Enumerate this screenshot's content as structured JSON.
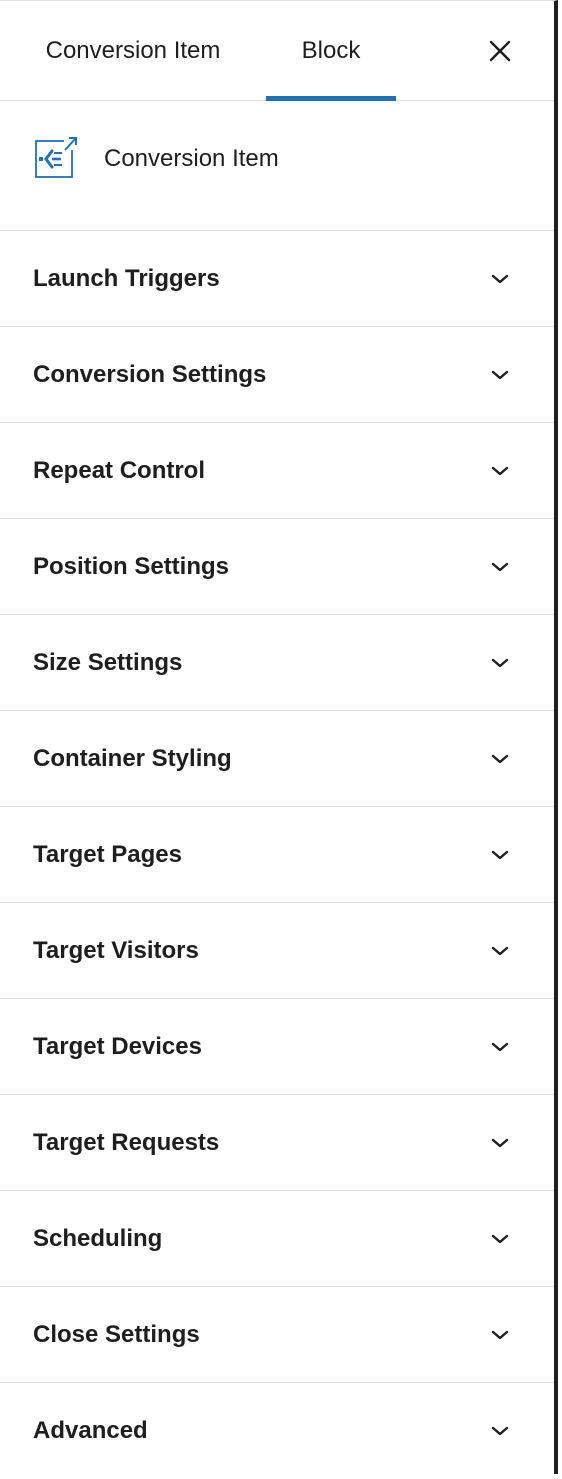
{
  "tabs": {
    "items": [
      {
        "label": "Conversion Item",
        "active": false
      },
      {
        "label": "Block",
        "active": true
      }
    ],
    "close_icon": "close-icon"
  },
  "block": {
    "title": "Conversion Item",
    "icon": "conversion-item-icon"
  },
  "sections": [
    {
      "label": "Launch Triggers",
      "icon": "chevron-down-icon"
    },
    {
      "label": "Conversion Settings",
      "icon": "chevron-down-icon"
    },
    {
      "label": "Repeat Control",
      "icon": "chevron-down-icon"
    },
    {
      "label": "Position Settings",
      "icon": "chevron-down-icon"
    },
    {
      "label": "Size Settings",
      "icon": "chevron-down-icon"
    },
    {
      "label": "Container Styling",
      "icon": "chevron-down-icon"
    },
    {
      "label": "Target Pages",
      "icon": "chevron-down-icon"
    },
    {
      "label": "Target Visitors",
      "icon": "chevron-down-icon"
    },
    {
      "label": "Target Devices",
      "icon": "chevron-down-icon"
    },
    {
      "label": "Target Requests",
      "icon": "chevron-down-icon"
    },
    {
      "label": "Scheduling",
      "icon": "chevron-down-icon"
    },
    {
      "label": "Close Settings",
      "icon": "chevron-down-icon"
    },
    {
      "label": "Advanced",
      "icon": "chevron-down-icon"
    }
  ],
  "colors": {
    "accent": "#2271b1",
    "text": "#1e1e1e",
    "divider": "#e0e0e0"
  }
}
